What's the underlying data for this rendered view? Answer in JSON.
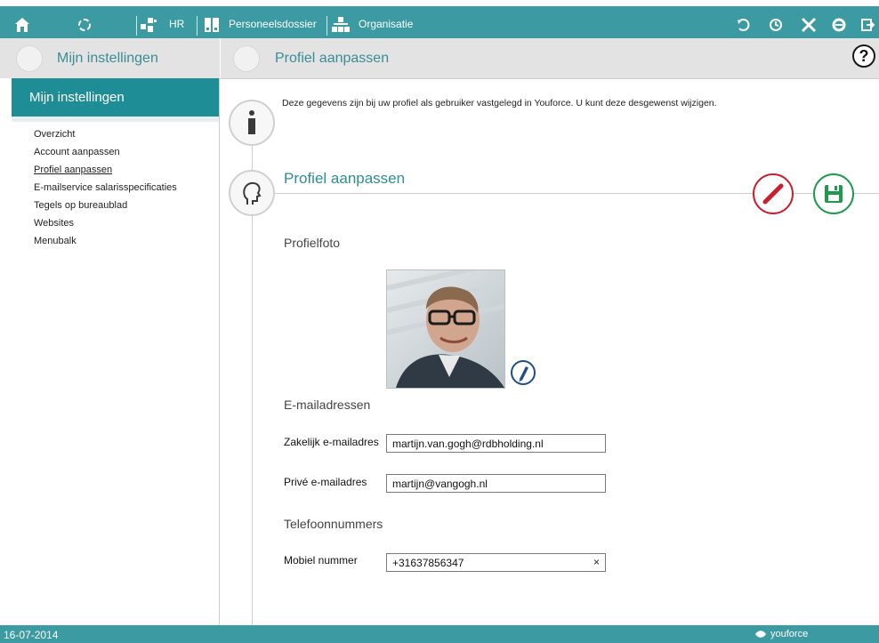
{
  "topbar": {
    "hr_label": "HR",
    "dossier_label": "Personeelsdossier",
    "org_label": "Organisatie"
  },
  "subbar": {
    "section_title": "Mijn instellingen",
    "page_title": "Profiel aanpassen",
    "help_label": "?"
  },
  "sidebar": {
    "header": "Mijn instellingen",
    "items": [
      {
        "label": "Overzicht"
      },
      {
        "label": "Account aanpassen"
      },
      {
        "label": "Profiel aanpassen"
      },
      {
        "label": "E-mailservice salarisspecificaties"
      },
      {
        "label": "Tegels op bureaublad"
      },
      {
        "label": "Websites"
      },
      {
        "label": "Menubalk"
      }
    ]
  },
  "main": {
    "info_text": "Deze gegevens zijn bij uw profiel als gebruiker vastgelegd in Youforce. U kunt deze desgewenst wijzigen.",
    "section_title": "Profiel aanpassen",
    "photo_heading": "Profielfoto",
    "email_heading": "E-mailadressen",
    "business_email_label": "Zakelijk e-mailadres",
    "business_email_value": "martijn.van.gogh@rdbholding.nl",
    "private_email_label": "Privé e-mailadres",
    "private_email_value": "martijn@vangogh.nl",
    "phone_heading": "Telefoonnummers",
    "mobile_label": "Mobiel nummer",
    "mobile_value": "+31637856347",
    "clear_symbol": "×"
  },
  "footer": {
    "date": "16-07-2014",
    "brand": "youforce"
  },
  "colors": {
    "teal": "#3b9aa2",
    "sidebar_header": "#1f8d95",
    "cancel_red": "#c8202e",
    "save_green": "#1e9a4c"
  }
}
